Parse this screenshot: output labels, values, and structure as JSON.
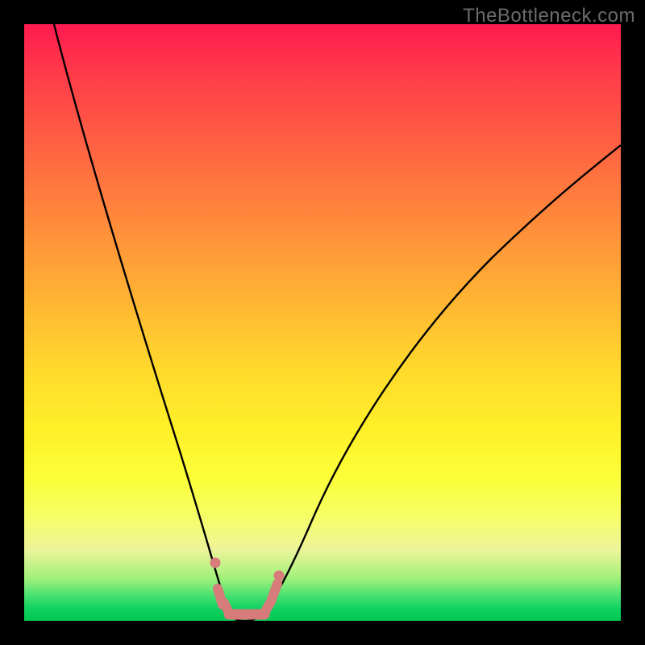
{
  "watermark": "TheBottleneck.com",
  "colors": {
    "frame": "#000000",
    "curve": "#000000",
    "marker": "#d77b7b",
    "watermark_text": "#6b6b6b"
  },
  "chart_data": {
    "type": "line",
    "title": "",
    "xlabel": "",
    "ylabel": "",
    "xlim": [
      0,
      100
    ],
    "ylim": [
      0,
      100
    ],
    "grid": false,
    "legend": false,
    "annotations": [
      {
        "text": "TheBottleneck.com",
        "position": "top-right"
      }
    ],
    "series": [
      {
        "name": "bottleneck-curve",
        "description": "Black V-shaped curve; y=0 is the bottom (optimal), y=100 is the top (severe bottleneck). Approximate values read from the image.",
        "x": [
          5,
          8,
          12,
          16,
          20,
          24,
          27,
          30,
          32,
          34,
          35,
          36,
          37,
          38,
          40,
          42,
          44,
          48,
          54,
          62,
          72,
          84,
          100
        ],
        "values": [
          100,
          88,
          74,
          60,
          47,
          34,
          24,
          15,
          8,
          3,
          1,
          0,
          0,
          1,
          3,
          6,
          10,
          18,
          30,
          43,
          56,
          68,
          80
        ]
      }
    ],
    "markers": {
      "description": "Salmon-colored points and short strokes near the curve's minimum (near bottom of plot).",
      "points": [
        {
          "x": 32.0,
          "y": 9.5
        },
        {
          "x": 32.8,
          "y": 4.0
        },
        {
          "x": 33.4,
          "y": 2.0
        },
        {
          "x": 34.2,
          "y": 0.8
        },
        {
          "x": 35.2,
          "y": 0.3
        },
        {
          "x": 36.4,
          "y": 0.1
        },
        {
          "x": 37.6,
          "y": 0.1
        },
        {
          "x": 38.8,
          "y": 0.3
        },
        {
          "x": 39.8,
          "y": 0.9
        },
        {
          "x": 40.8,
          "y": 2.2
        },
        {
          "x": 41.6,
          "y": 4.8
        },
        {
          "x": 42.2,
          "y": 7.6
        }
      ]
    },
    "background_gradient": {
      "orientation": "vertical",
      "stops": [
        {
          "pos": 0.0,
          "color": "#ff1a50"
        },
        {
          "pos": 0.5,
          "color": "#ffda2c"
        },
        {
          "pos": 0.82,
          "color": "#f6ff62"
        },
        {
          "pos": 0.96,
          "color": "#40e070"
        },
        {
          "pos": 1.0,
          "color": "#00c850"
        }
      ]
    }
  }
}
